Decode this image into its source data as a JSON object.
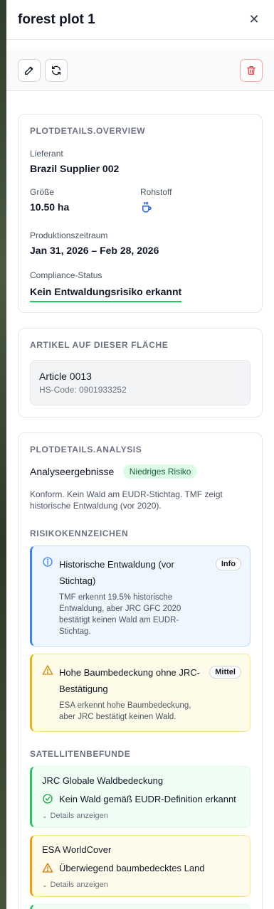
{
  "header": {
    "title": "forest plot 1",
    "close_icon": "close-icon"
  },
  "toolbar": {
    "edit_icon": "pencil-icon",
    "refresh_icon": "refresh-icon",
    "delete_icon": "trash-icon"
  },
  "overview": {
    "title": "PLOTDETAILS.OVERVIEW",
    "supplier_label": "Lieferant",
    "supplier_value": "Brazil Supplier 002",
    "size_label": "Größe",
    "size_value": "10.50 ha",
    "commodity_label": "Rohstoff",
    "commodity_icon": "coffee-cup-icon",
    "period_label": "Produktionszeitraum",
    "period_value": "Jan 31, 2026 – Feb 28, 2026",
    "compliance_label": "Compliance-Status",
    "compliance_value": "Kein Entwaldungsrisiko erkannt"
  },
  "articles": {
    "title": "ARTIKEL AUF DIESER FLÄCHE",
    "items": [
      {
        "name": "Article 0013",
        "hs": "HS-Code: 0901933252"
      }
    ]
  },
  "analysis": {
    "title": "PLOTDETAILS.ANALYSIS",
    "results_label": "Analyseergebnisse",
    "risk_badge": "Niedriges Risiko",
    "summary": "Konform. Kein Wald am EUDR-Stichtag. TMF zeigt historische Entwaldung (vor 2020).",
    "flags_title": "RISIKOKENNZEICHEN",
    "flags": [
      {
        "title": "Historische Entwaldung (vor Stichtag)",
        "desc": "TMF erkennt 19.5% historische Entwaldung, aber JRC GFC 2020 bestätigt keinen Wald am EUDR-Stichtag.",
        "badge": "Info",
        "icon": "info-icon"
      },
      {
        "title": "Hohe Baumbedeckung ohne JRC-Bestätigung",
        "desc": "ESA erkennt hohe Baumbedeckung, aber JRC bestätigt keinen Wald.",
        "badge": "Mittel",
        "icon": "warning-icon"
      }
    ],
    "satellite_title": "SATELLITENBEFUNDE",
    "satellite": [
      {
        "title": "JRC Globale Waldbedeckung",
        "finding": "Kein Wald gemäß EUDR-Definition erkannt",
        "details": "Details anzeigen",
        "icon": "check-circle-icon"
      },
      {
        "title": "ESA WorldCover",
        "finding": "Überwiegend baumbedecktes Land",
        "details": "Details anzeigen",
        "icon": "warning-icon"
      }
    ]
  },
  "colors": {
    "accent_green": "#22c55e",
    "info_blue": "#3b82f6",
    "warn_yellow": "#eab308",
    "danger_red": "#ef4444"
  }
}
